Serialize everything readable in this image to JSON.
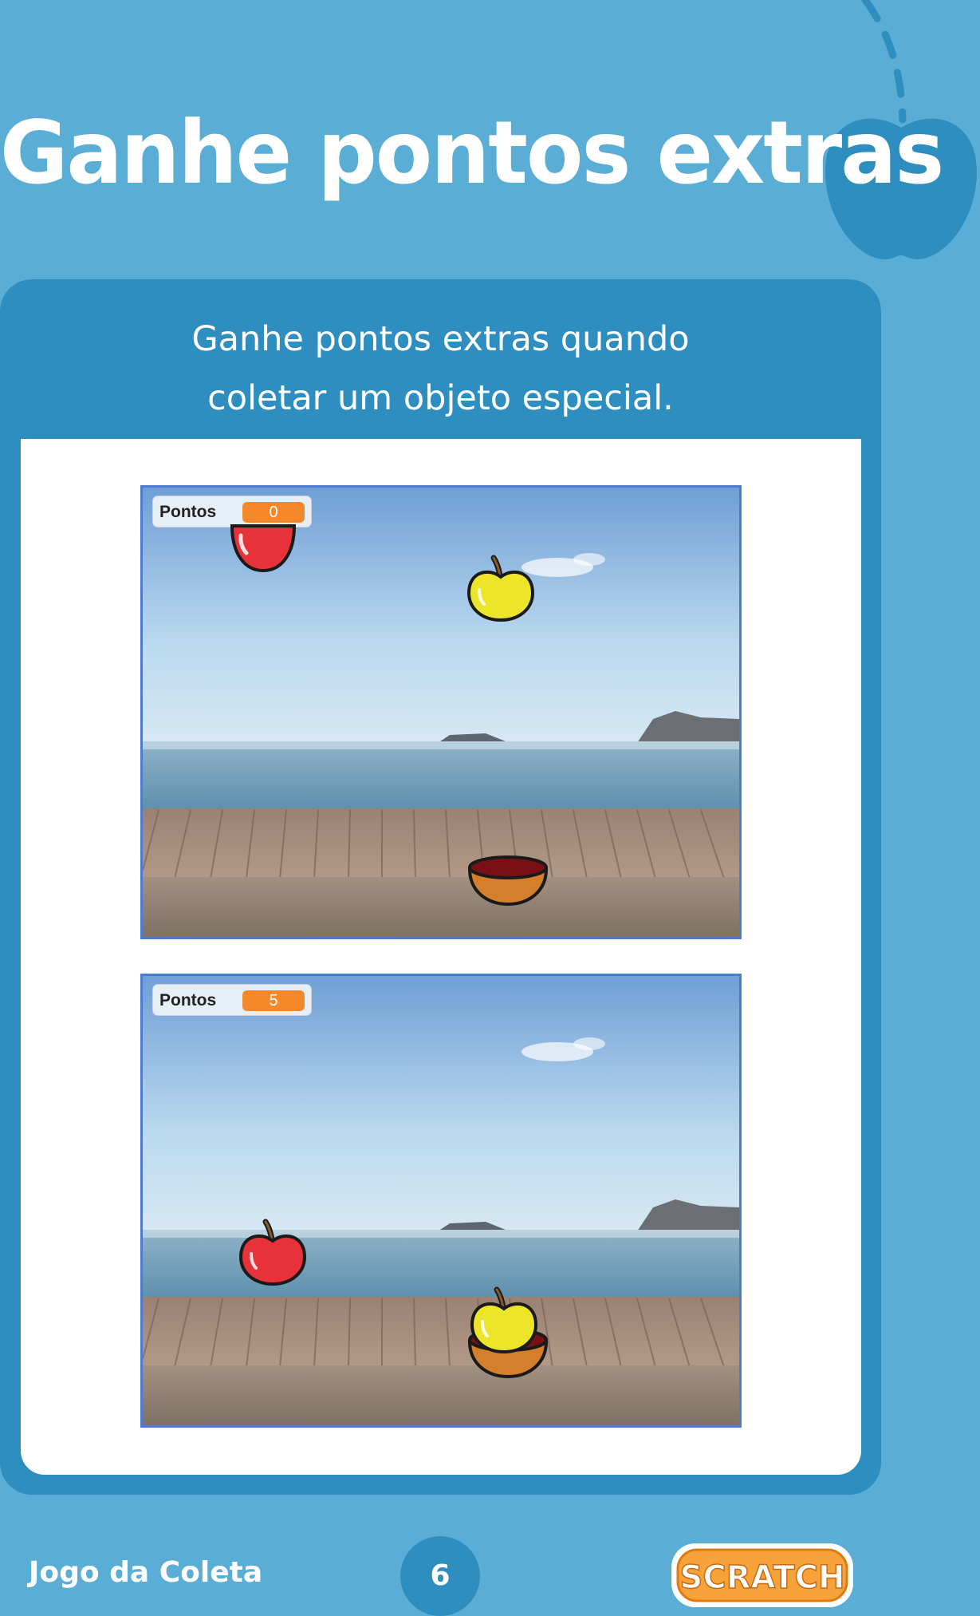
{
  "page": {
    "title": "Ganhe pontos extras",
    "subtitle_lines": [
      "Ganhe pontos extras quando",
      "coletar um objeto especial."
    ],
    "footer_title": "Jogo da Coleta",
    "page_number": "6",
    "logo_text": "SCRATCH"
  },
  "stage_before": {
    "monitor_label": "Pontos",
    "monitor_value": "0"
  },
  "stage_after": {
    "monitor_label": "Pontos",
    "monitor_value": "5"
  },
  "colors": {
    "background": "#5aaed5",
    "card": "#2e8ec0",
    "monitor_value": "#f4882a",
    "red_apple": "#e8323a",
    "yellow_apple": "#ece52a",
    "bowl": "#d47f2c"
  },
  "icons": [
    "apple-icon",
    "red-apple-icon",
    "yellow-apple-icon",
    "bowl-icon",
    "scratch-logo"
  ]
}
